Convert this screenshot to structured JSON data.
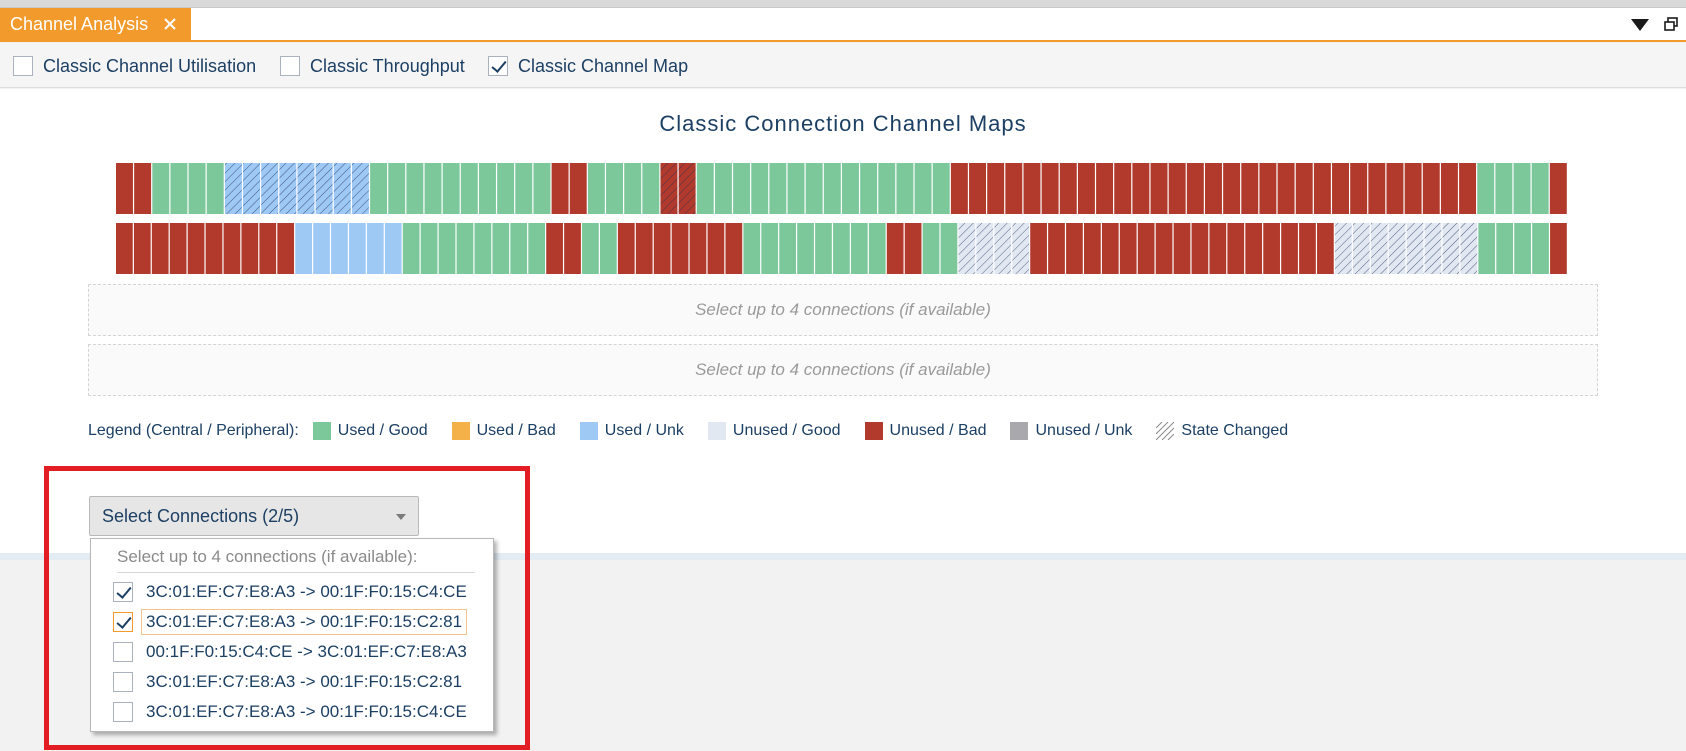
{
  "tab": {
    "title": "Channel Analysis"
  },
  "options": [
    {
      "label": "Classic Channel Utilisation",
      "checked": false
    },
    {
      "label": "Classic Throughput",
      "checked": false
    },
    {
      "label": "Classic Channel Map",
      "checked": true
    }
  ],
  "map": {
    "title": "Classic Connection Channel Maps",
    "row1": [
      "B",
      "B",
      "G",
      "G",
      "G",
      "G",
      "US",
      "US",
      "US",
      "US",
      "US",
      "US",
      "US",
      "US",
      "G",
      "G",
      "G",
      "G",
      "G",
      "G",
      "G",
      "G",
      "G",
      "G",
      "B",
      "B",
      "G",
      "G",
      "G",
      "G",
      "BS",
      "BS",
      "G",
      "G",
      "G",
      "G",
      "G",
      "G",
      "G",
      "G",
      "G",
      "G",
      "G",
      "G",
      "G",
      "G",
      "B",
      "B",
      "B",
      "B",
      "B",
      "B",
      "B",
      "B",
      "B",
      "B",
      "B",
      "B",
      "B",
      "B",
      "B",
      "B",
      "B",
      "B",
      "B",
      "B",
      "B",
      "B",
      "B",
      "B",
      "B",
      "B",
      "B",
      "B",
      "B",
      "G",
      "G",
      "G",
      "G",
      "B"
    ],
    "row2": [
      "B",
      "B",
      "B",
      "B",
      "B",
      "B",
      "B",
      "B",
      "B",
      "B",
      "U",
      "U",
      "U",
      "U",
      "U",
      "U",
      "G",
      "G",
      "G",
      "G",
      "G",
      "G",
      "G",
      "G",
      "B",
      "B",
      "G",
      "G",
      "B",
      "B",
      "B",
      "B",
      "B",
      "B",
      "B",
      "G",
      "G",
      "G",
      "G",
      "G",
      "G",
      "G",
      "G",
      "B",
      "B",
      "G",
      "G",
      "NS",
      "NS",
      "NS",
      "NS",
      "B",
      "B",
      "B",
      "B",
      "B",
      "B",
      "B",
      "B",
      "B",
      "B",
      "B",
      "B",
      "B",
      "B",
      "B",
      "B",
      "B",
      "NS",
      "NS",
      "NS",
      "NS",
      "NS",
      "NS",
      "NS",
      "NS",
      "G",
      "G",
      "G",
      "G",
      "B"
    ],
    "placeholder_1": "Select up to 4 connections (if available)",
    "placeholder_2": "Select up to 4 connections (if available)"
  },
  "colors": {
    "used_good": "#7dc89b",
    "used_bad": "#f4b14a",
    "used_unk": "#9ec9f5",
    "unused_good": "#e2e8f2",
    "unused_bad": "#b23a2c",
    "unused_unk": "#a9a9ad",
    "accent": "#f39a2c",
    "highlight": "#e21d24"
  },
  "legend": {
    "label": "Legend (Central / Peripheral):",
    "items": [
      {
        "label": "Used / Good",
        "color": "#7dc89b"
      },
      {
        "label": "Used / Bad",
        "color": "#f4b14a"
      },
      {
        "label": "Used / Unk",
        "color": "#9ec9f5"
      },
      {
        "label": "Unused / Good",
        "color": "#e2e8f2"
      },
      {
        "label": "Unused / Bad",
        "color": "#b23a2c"
      },
      {
        "label": "Unused / Unk",
        "color": "#a9a9ad"
      },
      {
        "label": "State Changed",
        "color": "hatched"
      }
    ]
  },
  "selector": {
    "button_label": "Select Connections (2/5)",
    "header": "Select up to 4 connections (if available):",
    "connections": [
      {
        "label": "3C:01:EF:C7:E8:A3 -> 00:1F:F0:15:C4:CE",
        "checked": true
      },
      {
        "label": "3C:01:EF:C7:E8:A3 -> 00:1F:F0:15:C2:81",
        "checked": true
      },
      {
        "label": "00:1F:F0:15:C4:CE -> 3C:01:EF:C7:E8:A3",
        "checked": false
      },
      {
        "label": "3C:01:EF:C7:E8:A3 -> 00:1F:F0:15:C2:81",
        "checked": false
      },
      {
        "label": "3C:01:EF:C7:E8:A3 -> 00:1F:F0:15:C4:CE",
        "checked": false
      }
    ]
  }
}
